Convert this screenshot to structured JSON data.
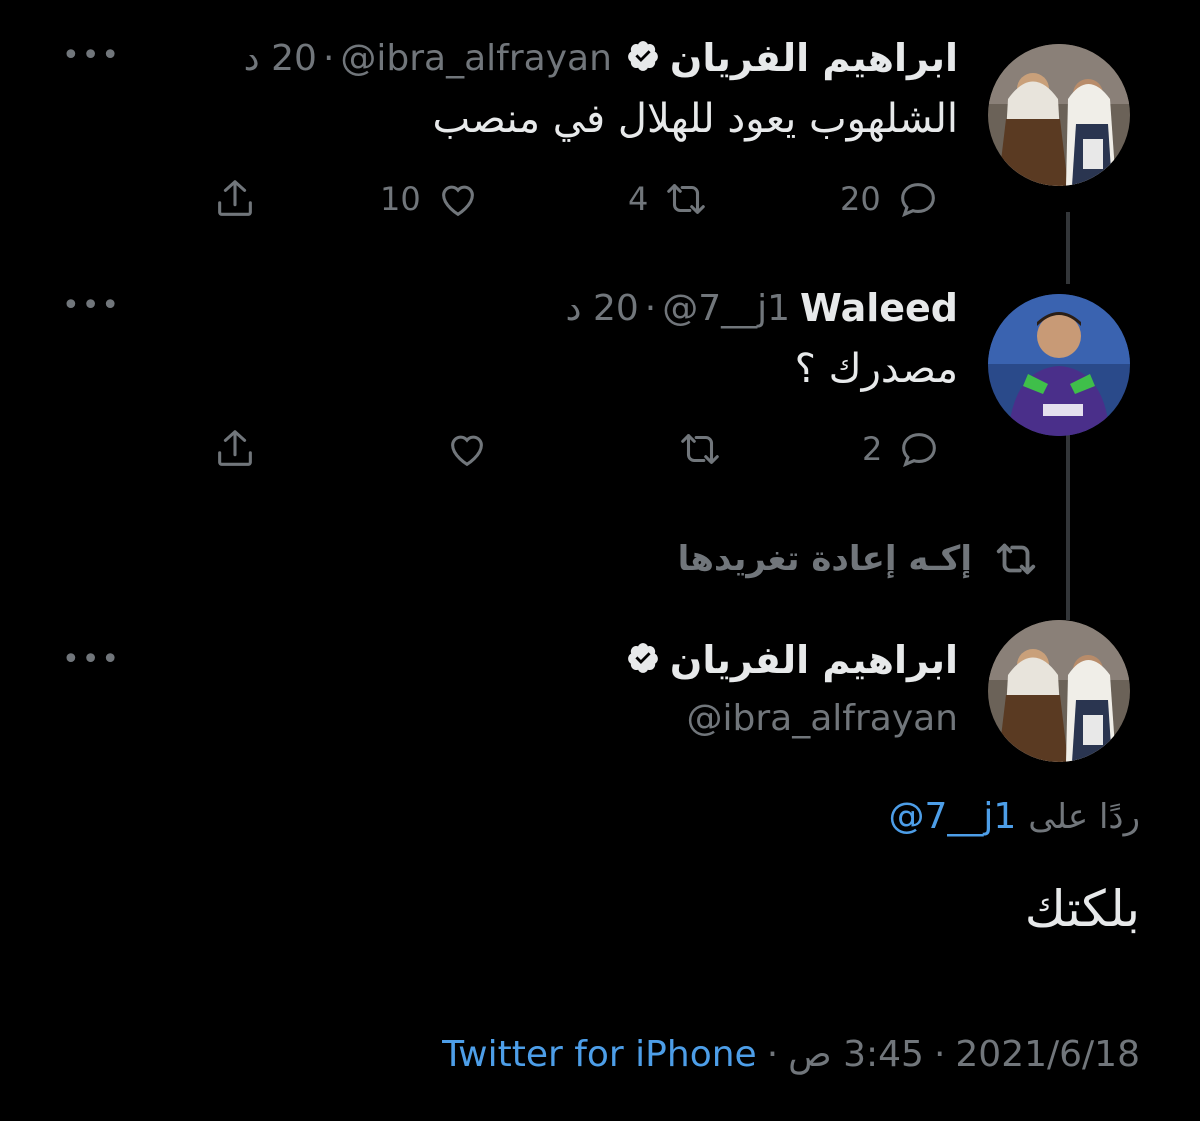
{
  "tweet1": {
    "name": "ابراهيم الفريان",
    "handle": "@ibra_alfrayan",
    "separator": "·",
    "time": "20 د",
    "text": "الشلهوب يعود للهلال في منصب",
    "replies": "20",
    "retweets": "4",
    "likes": "10"
  },
  "tweet2": {
    "name": "Waleed",
    "handle": "@7__j1",
    "separator": "·",
    "time": "20 د",
    "text": "مصدرك ؟",
    "replies": "2"
  },
  "retweet_notice": "إكـه إعادة تغريدها",
  "main_tweet": {
    "name": "ابراهيم الفريان",
    "handle": "@ibra_alfrayan",
    "replying_prefix": "ردًا على",
    "replying_to": "@7__j1",
    "text": "بلكتك",
    "date": "2021/6/18",
    "time": "3:45 ص",
    "separator": "·",
    "source": "Twitter for iPhone"
  },
  "menu_label": "•••",
  "colors": {
    "background": "#000000",
    "text": "#e7e9ea",
    "muted": "#71767b",
    "link": "#4d9ee8"
  },
  "icons": [
    "verified-badge-icon",
    "reply-icon",
    "retweet-icon",
    "like-icon",
    "share-icon",
    "more-icon"
  ]
}
